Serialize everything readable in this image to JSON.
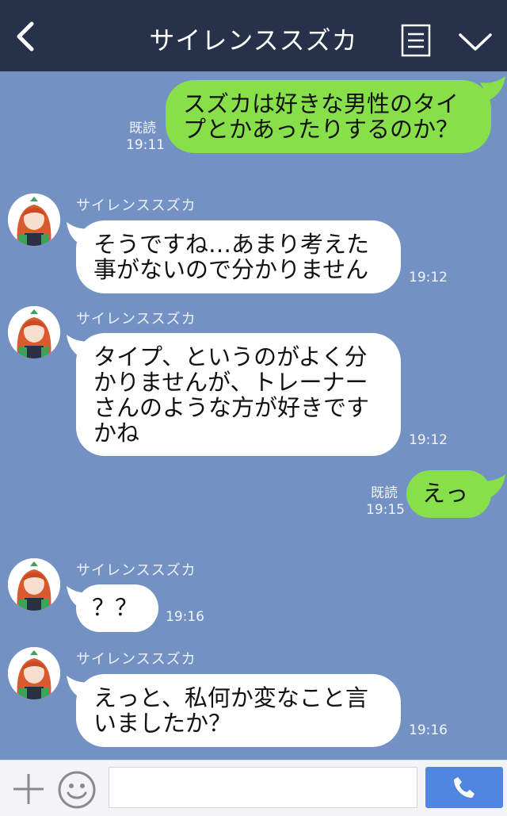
{
  "header": {
    "title": "サイレンススズカ"
  },
  "messages": [
    {
      "side": "right",
      "text": "スズカは好きな男性のタイプとかあったりするのか？",
      "read": "既読",
      "time": "19:11"
    },
    {
      "side": "left",
      "sender": "サイレンススズカ",
      "text": "そうですね…あまり考えた事がないので分かりません",
      "time": "19:12"
    },
    {
      "side": "left",
      "sender": "サイレンススズカ",
      "text": "タイプ、というのがよく分かりませんが、トレーナーさんのような方が好きですかね",
      "time": "19:12"
    },
    {
      "side": "right",
      "text": "えっ",
      "read": "既読",
      "time": "19:15"
    },
    {
      "side": "left",
      "sender": "サイレンススズカ",
      "text": "？？",
      "time": "19:16"
    },
    {
      "side": "left",
      "sender": "サイレンススズカ",
      "text": "えっと、私何か変なこと言いましたか？",
      "time": "19:16"
    }
  ],
  "footer": {
    "input_placeholder": ""
  },
  "colors": {
    "header_bg": "#27324a",
    "chat_bg": "#7491c4",
    "outgoing_bubble": "#87e04a",
    "incoming_bubble": "#ffffff",
    "call_button": "#4f86e0"
  },
  "icons": [
    "back-arrow-icon",
    "menu-icon",
    "chevron-down-icon",
    "plus-icon",
    "emoji-icon",
    "phone-icon"
  ]
}
